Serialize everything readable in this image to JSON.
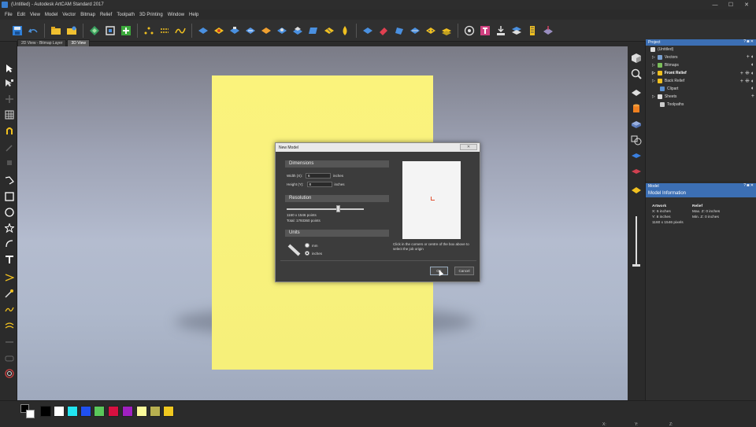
{
  "window": {
    "title": "(Untitled) - Autodesk ArtCAM Standard 2017",
    "minimize": "—",
    "maximize": "☐",
    "close": "✕"
  },
  "menu": [
    "File",
    "Edit",
    "View",
    "Model",
    "Vector",
    "Bitmap",
    "Relief",
    "Toolpath",
    "3D Printing",
    "Window",
    "Help"
  ],
  "tabs": [
    {
      "label": "2D View - Bitmap Layer",
      "active": false
    },
    {
      "label": "3D View",
      "active": true
    }
  ],
  "dialog": {
    "title": "New Model",
    "close": "✕",
    "dimensions": {
      "header": "Dimensions",
      "width_label": "Width (X):",
      "width_value": "6",
      "width_unit": "inches",
      "height_label": "Height (Y):",
      "height_value": "8",
      "height_unit": "inches"
    },
    "resolution": {
      "header": "Resolution",
      "slider_fraction": 0.67,
      "points": "1160 x 1546 points",
      "total": "Total: 1793360 points"
    },
    "units": {
      "header": "Units",
      "mm": "mm",
      "inches": "inches",
      "selected": "inches"
    },
    "instruction": "Click in the corners or centre of the box above to select the job origin",
    "ok": "OK",
    "cancel": "Cancel"
  },
  "project_panel": {
    "title": "Project",
    "header_buttons": "? ◙ ✕",
    "items": [
      {
        "label": "(Untitled)",
        "icon_color": "#dddddd",
        "bold": false,
        "right": ""
      },
      {
        "label": "Vectors",
        "icon_color": "#7aa0d0",
        "bold": false,
        "right": "+ ◐"
      },
      {
        "label": "Bitmaps",
        "icon_color": "#7bbf5a",
        "bold": false,
        "right": "◐"
      },
      {
        "label": "Front Relief",
        "icon_color": "#f0c020",
        "bold": true,
        "right": "+ ⁜ ◐"
      },
      {
        "label": "Back Relief",
        "icon_color": "#f0c020",
        "bold": false,
        "right": "+ ⁜ ◐"
      },
      {
        "label": "Clipart",
        "icon_color": "#5a8fd0",
        "bold": false,
        "right": "◐"
      },
      {
        "label": "Sheets",
        "icon_color": "#dddddd",
        "bold": false,
        "right": "+"
      },
      {
        "label": "Toolpaths",
        "icon_color": "#cccccc",
        "bold": false,
        "right": ""
      }
    ]
  },
  "model_panel": {
    "title": "Model",
    "info_title": "Model Information",
    "artwork_header": "Artwork",
    "relief_header": "Relief",
    "artwork_lines": [
      "X: 6 inches",
      "Y: 8 inches",
      "1160 x 1546 pixels"
    ],
    "relief_lines": [
      "Max. Z: 0 inches",
      "Min. Z: 0 inches"
    ]
  },
  "palette": [
    "#000000",
    "#ffffff",
    "#22e5f0",
    "#2050f0",
    "#5ac85a",
    "#d81040",
    "#a020c0",
    "#fafa9a",
    "#b8b050",
    "#f0c820"
  ],
  "status": {
    "x": "X:",
    "y": "Y:",
    "z": "Z:"
  },
  "colors": {
    "material": "#f9f27e",
    "accent": "#3c6fb4",
    "origin": "#e05030"
  }
}
